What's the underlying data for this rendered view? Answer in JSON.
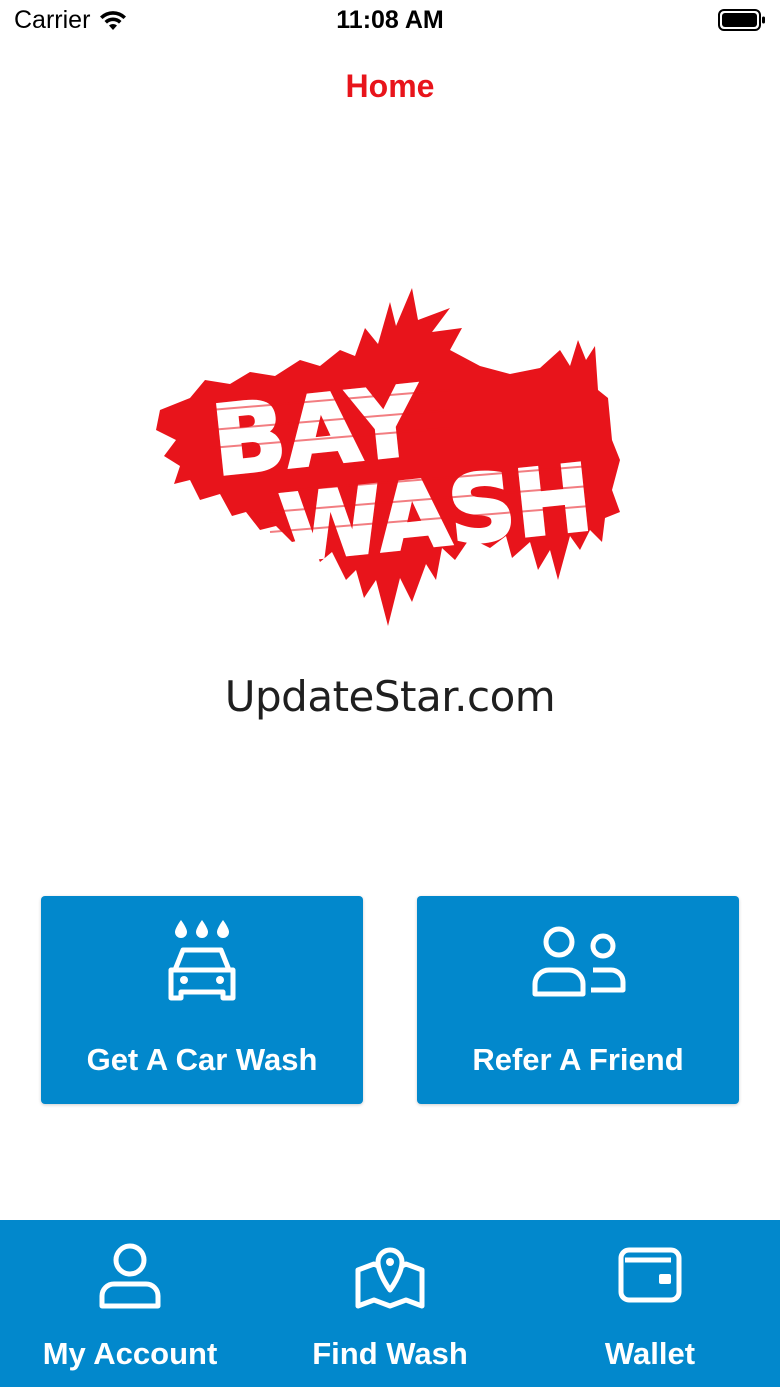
{
  "status_bar": {
    "carrier": "Carrier",
    "time": "11:08 AM"
  },
  "nav": {
    "title": "Home"
  },
  "logo": {
    "text": "BAY WASH",
    "color": "#e8141b"
  },
  "watermark": "UpdateStar.com",
  "actions": [
    {
      "label": "Get A Car Wash",
      "icon": "car-wash-icon"
    },
    {
      "label": "Refer A Friend",
      "icon": "users-icon"
    }
  ],
  "tabs": [
    {
      "label": "My Account",
      "icon": "user-icon"
    },
    {
      "label": "Find Wash",
      "icon": "map-pin-icon"
    },
    {
      "label": "Wallet",
      "icon": "wallet-icon"
    }
  ],
  "colors": {
    "accent": "#0288cc",
    "title": "#e8141b"
  }
}
